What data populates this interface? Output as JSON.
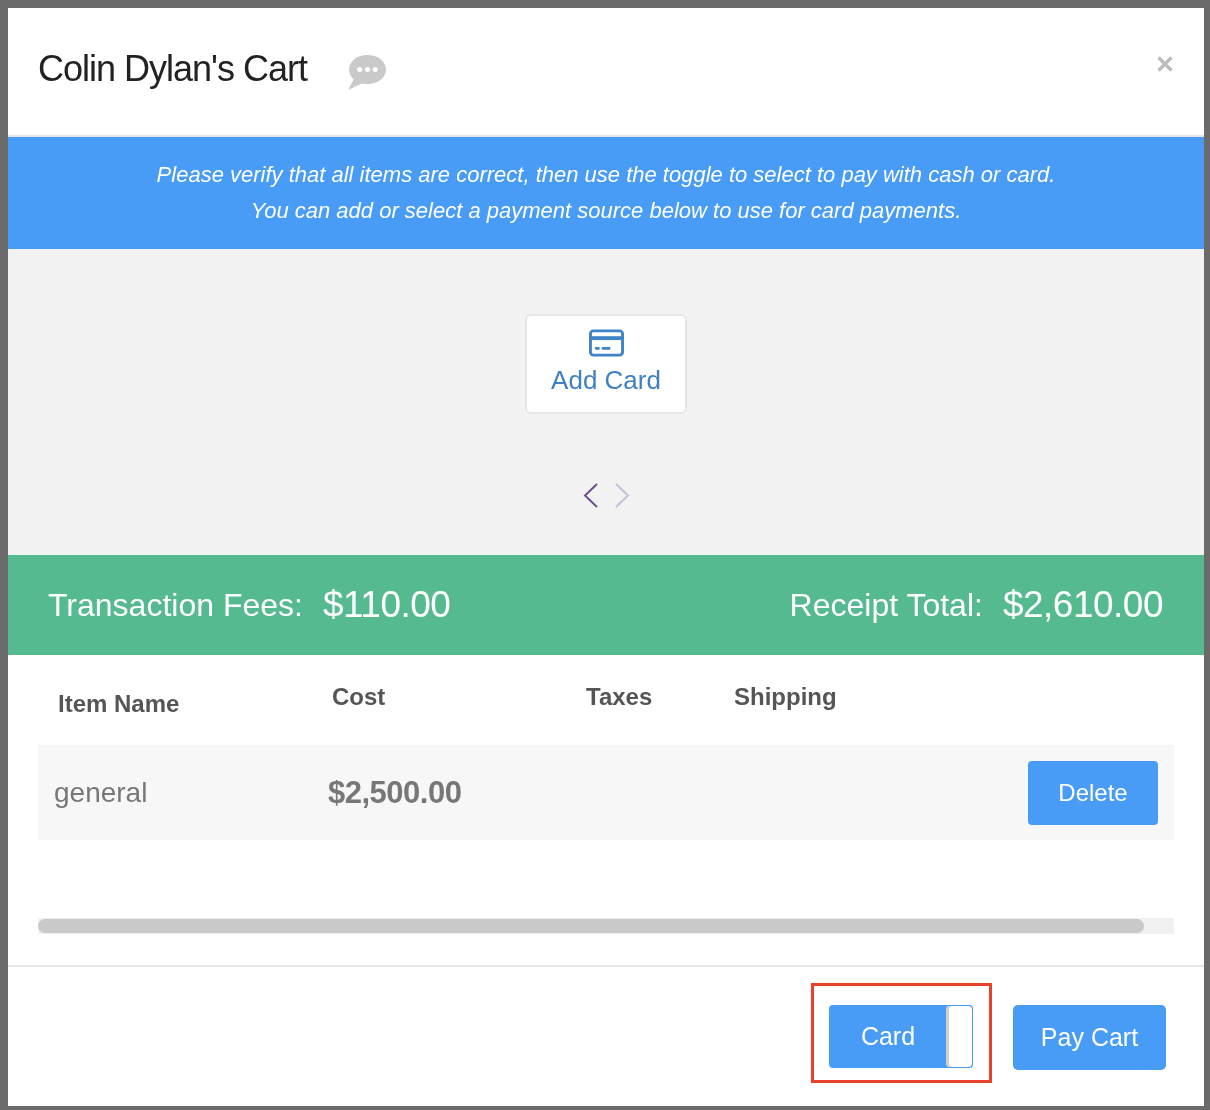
{
  "window": {
    "title": "Colin Dylan's Cart"
  },
  "banner": {
    "lines": [
      "Please verify that all items are correct, then use the toggle to select to pay with cash or card.",
      "You can add or select a payment source below to use for card payments."
    ]
  },
  "payment_sources": {
    "add_card_label": "Add Card",
    "carousel": {
      "prev_enabled": true,
      "next_enabled": false
    }
  },
  "totals": [
    {
      "label": "Transaction Fees:",
      "value": "$110.00"
    },
    {
      "label": "Receipt Total:",
      "value": "$2,610.00"
    }
  ],
  "table": {
    "columns": [
      "Item Name",
      "Cost",
      "Taxes",
      "Shipping"
    ],
    "rows": [
      {
        "item_name": "general",
        "cost": "$2,500.00",
        "delete_label": "Delete"
      }
    ]
  },
  "footer": {
    "payment_toggle": {
      "label": "Card",
      "on": true,
      "highlighted": true
    },
    "pay_button": {
      "label": "Pay Cart"
    }
  }
}
